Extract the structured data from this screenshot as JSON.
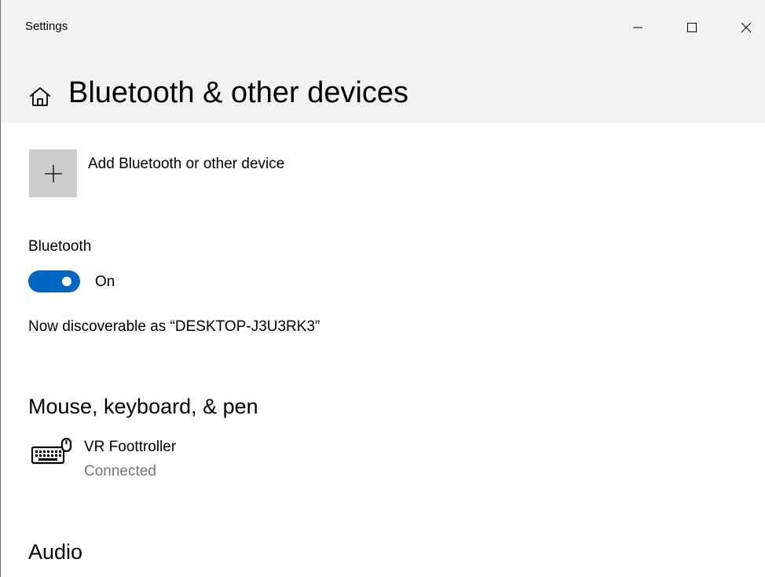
{
  "window": {
    "title": "Settings",
    "controls": {
      "minimize": "minimize-icon",
      "maximize": "maximize-icon",
      "close": "close-icon"
    }
  },
  "header": {
    "home_icon": "home-icon",
    "title": "Bluetooth & other devices"
  },
  "add_device": {
    "icon": "plus-icon",
    "label": "Add Bluetooth or other device"
  },
  "bluetooth": {
    "label": "Bluetooth",
    "toggle_on": true,
    "toggle_state": "On",
    "discoverable_text": "Now discoverable as “DESKTOP-J3U3RK3”"
  },
  "sections": {
    "mouse_keyboard_pen": {
      "title": "Mouse, keyboard, & pen",
      "devices": [
        {
          "icon": "keyboard-mouse-icon",
          "name": "VR Foottroller",
          "status": "Connected"
        }
      ]
    },
    "audio": {
      "title": "Audio"
    }
  },
  "colors": {
    "accent": "#0067c0",
    "header_bg": "#f2f2f2",
    "tile_bg": "#cccccc",
    "secondary_text": "#767676"
  }
}
